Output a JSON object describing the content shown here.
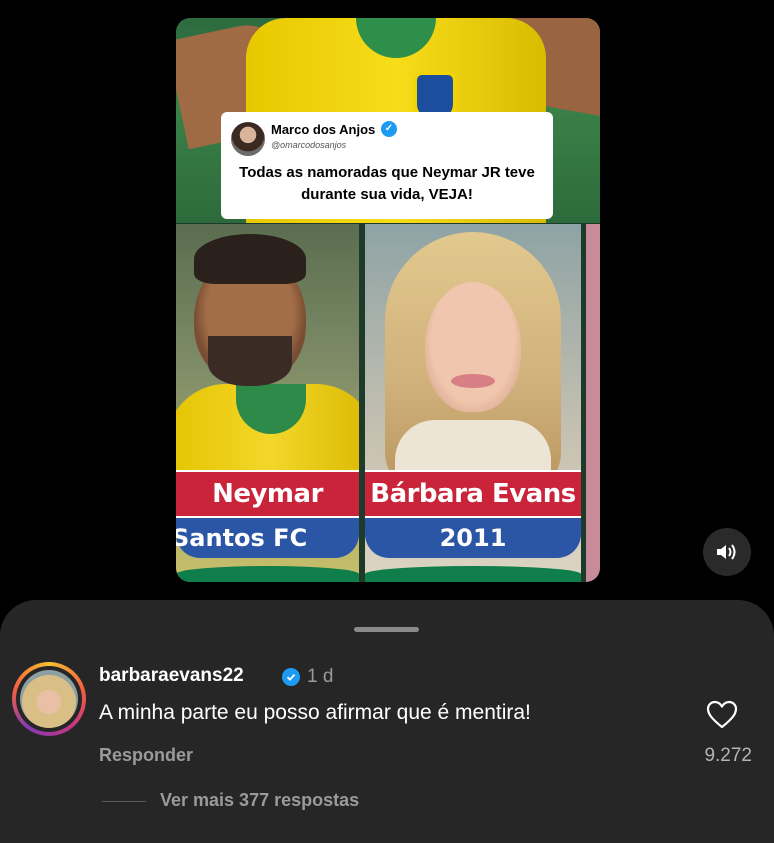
{
  "video": {
    "tweet": {
      "author": "Marco dos Anjos",
      "handle": "@omarcodosanjos",
      "text": "Todas as namoradas que Neymar JR teve durante sua vida, VEJA!",
      "verified_icon": "✓"
    },
    "cards": [
      {
        "name": "Neymar",
        "subtitle": "Santos FC"
      },
      {
        "name": "Bárbara Evans",
        "subtitle": "2011"
      }
    ],
    "sound_icon": "speaker-icon"
  },
  "comment": {
    "username": "barbaraevans22",
    "time": "1 d",
    "text": "A minha parte eu posso afirmar que é mentira!",
    "reply_label": "Responder",
    "likes": "9.272",
    "more_replies": "Ver mais 377 respostas"
  },
  "colors": {
    "label_red": "#c9243a",
    "label_blue": "#2b56a5",
    "sheet_bg": "#262626",
    "verified_blue": "#1d9bf0"
  }
}
